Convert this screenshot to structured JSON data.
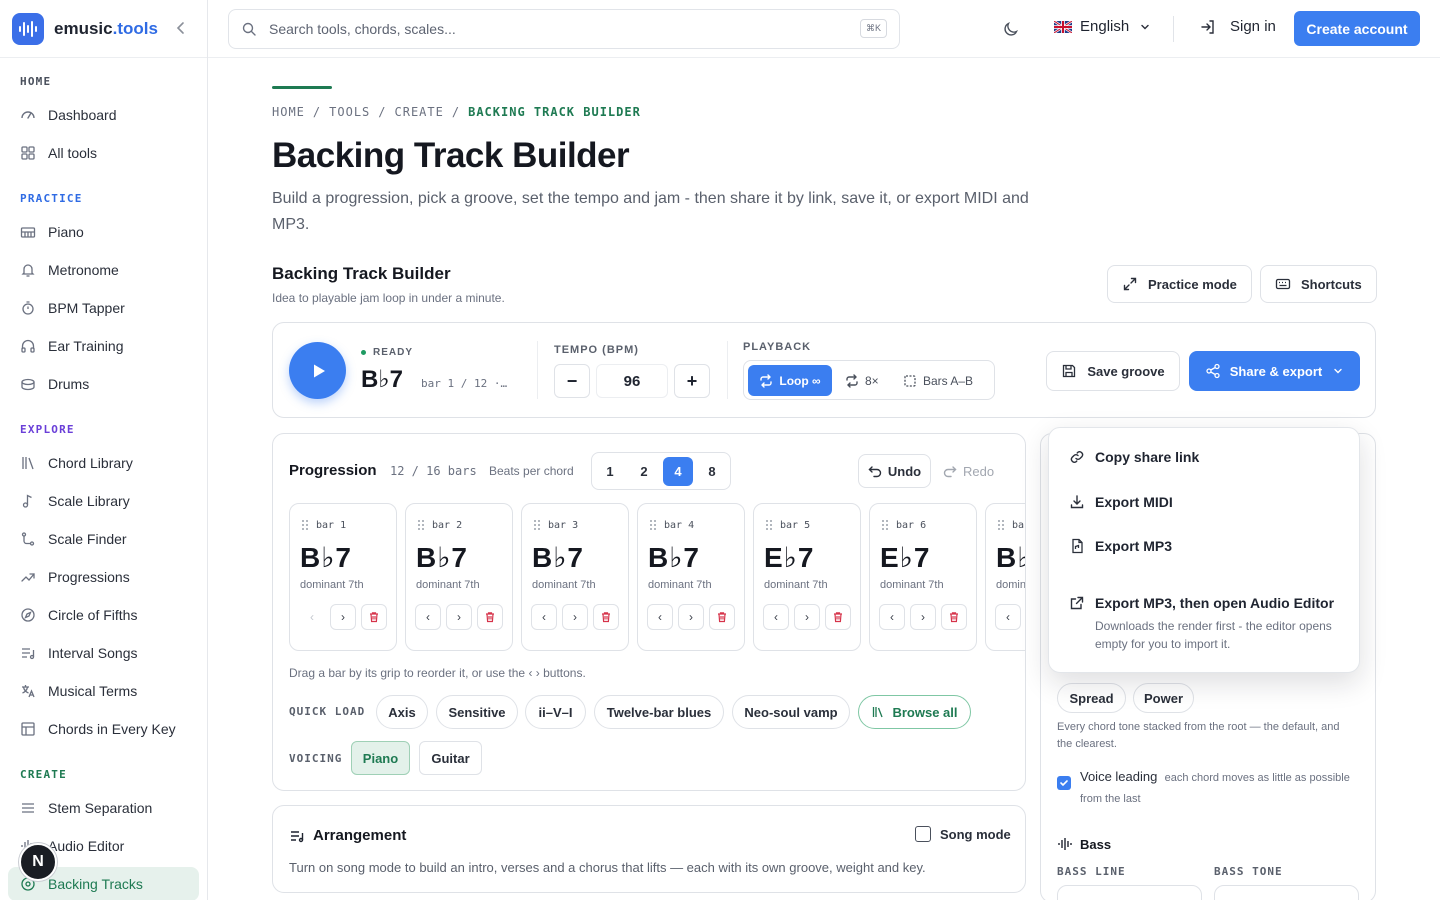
{
  "brand": {
    "name_main": "emusic",
    "name_accent": ".tools"
  },
  "sidebar": {
    "sections": [
      {
        "label": "HOME",
        "color": "#4a505c"
      },
      {
        "label": "PRACTICE",
        "color": "#2f6be4"
      },
      {
        "label": "EXPLORE",
        "color": "#6a3fd8"
      },
      {
        "label": "CREATE",
        "color": "#1e7a52"
      }
    ],
    "items": [
      {
        "label": "Dashboard",
        "icon": "gauge-icon"
      },
      {
        "label": "All tools",
        "icon": "grid-icon"
      },
      {
        "label": "Piano",
        "icon": "piano-icon"
      },
      {
        "label": "Metronome",
        "icon": "bell-icon"
      },
      {
        "label": "BPM Tapper",
        "icon": "stopwatch-icon"
      },
      {
        "label": "Ear Training",
        "icon": "headphones-icon"
      },
      {
        "label": "Drums",
        "icon": "drum-icon"
      },
      {
        "label": "Chord Library",
        "icon": "library-icon"
      },
      {
        "label": "Scale Library",
        "icon": "music-note-icon"
      },
      {
        "label": "Scale Finder",
        "icon": "route-icon"
      },
      {
        "label": "Progressions",
        "icon": "trending-up-icon"
      },
      {
        "label": "Circle of Fifths",
        "icon": "compass-icon"
      },
      {
        "label": "Interval Songs",
        "icon": "list-music-icon"
      },
      {
        "label": "Musical Terms",
        "icon": "translate-icon"
      },
      {
        "label": "Chords in Every Key",
        "icon": "table-icon"
      },
      {
        "label": "Stem Separation",
        "icon": "sliders-icon"
      },
      {
        "label": "Audio Editor",
        "icon": "waveform-icon"
      },
      {
        "label": "Backing Tracks",
        "icon": "disc-icon"
      }
    ],
    "badge": "N"
  },
  "topbar": {
    "search_placeholder": "Search tools, chords, scales...",
    "shortcut": "⌘K",
    "language": "English",
    "sign_in": "Sign in",
    "create_account": "Create account"
  },
  "page": {
    "breadcrumbs": [
      "HOME",
      "/",
      "TOOLS",
      "/",
      "CREATE",
      "/",
      "BACKING TRACK BUILDER"
    ],
    "title": "Backing Track Builder",
    "subtitle": "Build a progression, pick a groove, set the tempo and jam - then share it by link, save it, or export MIDI and MP3.",
    "section_title": "Backing Track Builder",
    "section_sub": "Idea to playable jam loop in under a minute.",
    "practice_mode": "Practice mode",
    "shortcuts": "Shortcuts"
  },
  "transport": {
    "status": "READY",
    "chord": "B♭7",
    "bar_position": "bar 1 / 12 ·…",
    "tempo_label": "TEMPO (BPM)",
    "tempo_minus": "−",
    "tempo_value": "96",
    "tempo_plus": "+",
    "playback_label": "PLAYBACK",
    "loop": "Loop ∞",
    "repeat": "8×",
    "bars_ab": "Bars A–B",
    "save_groove": "Save groove",
    "share_export": "Share & export"
  },
  "progression": {
    "title": "Progression",
    "count": "12 / 16 bars",
    "beats_label": "Beats per chord",
    "beats_options": [
      "1",
      "2",
      "4",
      "8"
    ],
    "beats_selected": "4",
    "undo": "Undo",
    "redo": "Redo",
    "bars": [
      {
        "label": "bar 1",
        "chord": "B♭7",
        "quality": "dominant 7th"
      },
      {
        "label": "bar 2",
        "chord": "B♭7",
        "quality": "dominant 7th"
      },
      {
        "label": "bar 3",
        "chord": "B♭7",
        "quality": "dominant 7th"
      },
      {
        "label": "bar 4",
        "chord": "B♭7",
        "quality": "dominant 7th"
      },
      {
        "label": "bar 5",
        "chord": "E♭7",
        "quality": "dominant 7th"
      },
      {
        "label": "bar 6",
        "chord": "E♭7",
        "quality": "dominant 7th"
      },
      {
        "label": "ba",
        "chord": "B♭",
        "quality": "domin"
      }
    ],
    "bar_prev": "‹",
    "bar_next": "›",
    "hint": "Drag a bar by its grip to reorder it, or use the ‹ › buttons.",
    "quick_load_label": "QUICK LOAD",
    "quick_load": [
      "Axis",
      "Sensitive",
      "ii–V–I",
      "Twelve-bar blues",
      "Neo-soul vamp"
    ],
    "browse_all": "Browse all",
    "voicing_label": "VOICING",
    "voicing_options": [
      "Piano",
      "Guitar"
    ],
    "voicing_selected": "Piano"
  },
  "arrangement": {
    "title": "Arrangement",
    "song_mode": "Song mode",
    "description": "Turn on song mode to build an intro, verses and a chorus that lifts — each with its own groove, weight and key."
  },
  "right_panel": {
    "chips": [
      "Spread",
      "Power"
    ],
    "chip_desc": "Every chord tone stacked from the root — the default, and the clearest.",
    "voice_leading": "Voice leading",
    "voice_leading_desc": "each chord moves as little as possible from the last",
    "bass_title": "Bass",
    "bass_line_label": "BASS LINE",
    "bass_tone_label": "BASS TONE"
  },
  "share_menu": {
    "copy_link": "Copy share link",
    "export_midi": "Export MIDI",
    "export_mp3": "Export MP3",
    "export_mp3_editor": "Export MP3, then open Audio Editor",
    "export_mp3_editor_desc": "Downloads the render first - the editor opens empty for you to import it."
  },
  "colors": {
    "accent_blue": "#3b7ef0",
    "accent_green": "#1e7a52",
    "danger": "#d6334a"
  }
}
